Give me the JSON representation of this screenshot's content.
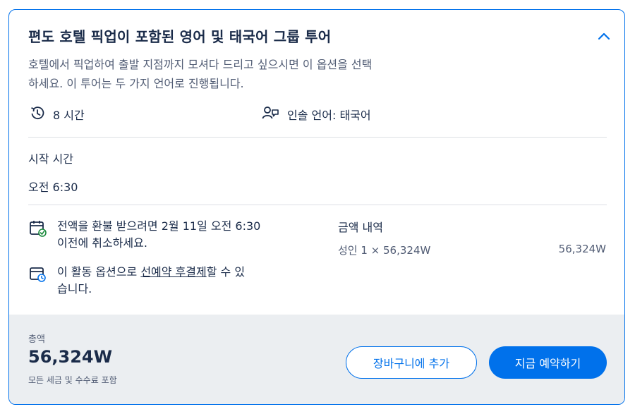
{
  "option": {
    "title": "편도 호텔 픽업이 포함된 영어 및 태국어 그룹 투어",
    "description_line1": "호텔에서 픽업하여 출발 지점까지 모셔다 드리고 싶으시면 이 옵션을 선택",
    "description_line2": "하세요. 이 투어는 두 가지 언어로 진행됩니다.",
    "duration": "8 시간",
    "guide_language": "인솔 언어: 태국어"
  },
  "start_time": {
    "label": "시작 시간",
    "value": "오전 6:30"
  },
  "cancellation": {
    "line1": "전액을 환불 받으려면 2월 11일 오전 6:30",
    "line2": "이전에 취소하세요."
  },
  "payment": {
    "prefix": "이 활동 옵션으로 ",
    "link": "선예약 후결제",
    "suffix_line1": "할 수 있",
    "line2": "습니다."
  },
  "price_breakdown": {
    "title": "금액 내역",
    "line_label": "성인 1 × 56,324W",
    "line_amount": "56,324W"
  },
  "footer": {
    "total_label": "총액",
    "total_value": "56,324W",
    "total_note": "모든 세금 및 수수료 포함",
    "cart_button": "장바구니에 추가",
    "book_button": "지금 예약하기"
  },
  "colors": {
    "accent": "#0071eb",
    "text": "#1a2b49",
    "muted": "#525d75",
    "footer_bg": "#ebeef1"
  },
  "icons": {
    "duration": "clock-history-icon",
    "language": "guide-language-icon",
    "cancellation": "calendar-check-icon",
    "payment": "calendar-clock-icon",
    "collapse": "chevron-up-icon"
  }
}
